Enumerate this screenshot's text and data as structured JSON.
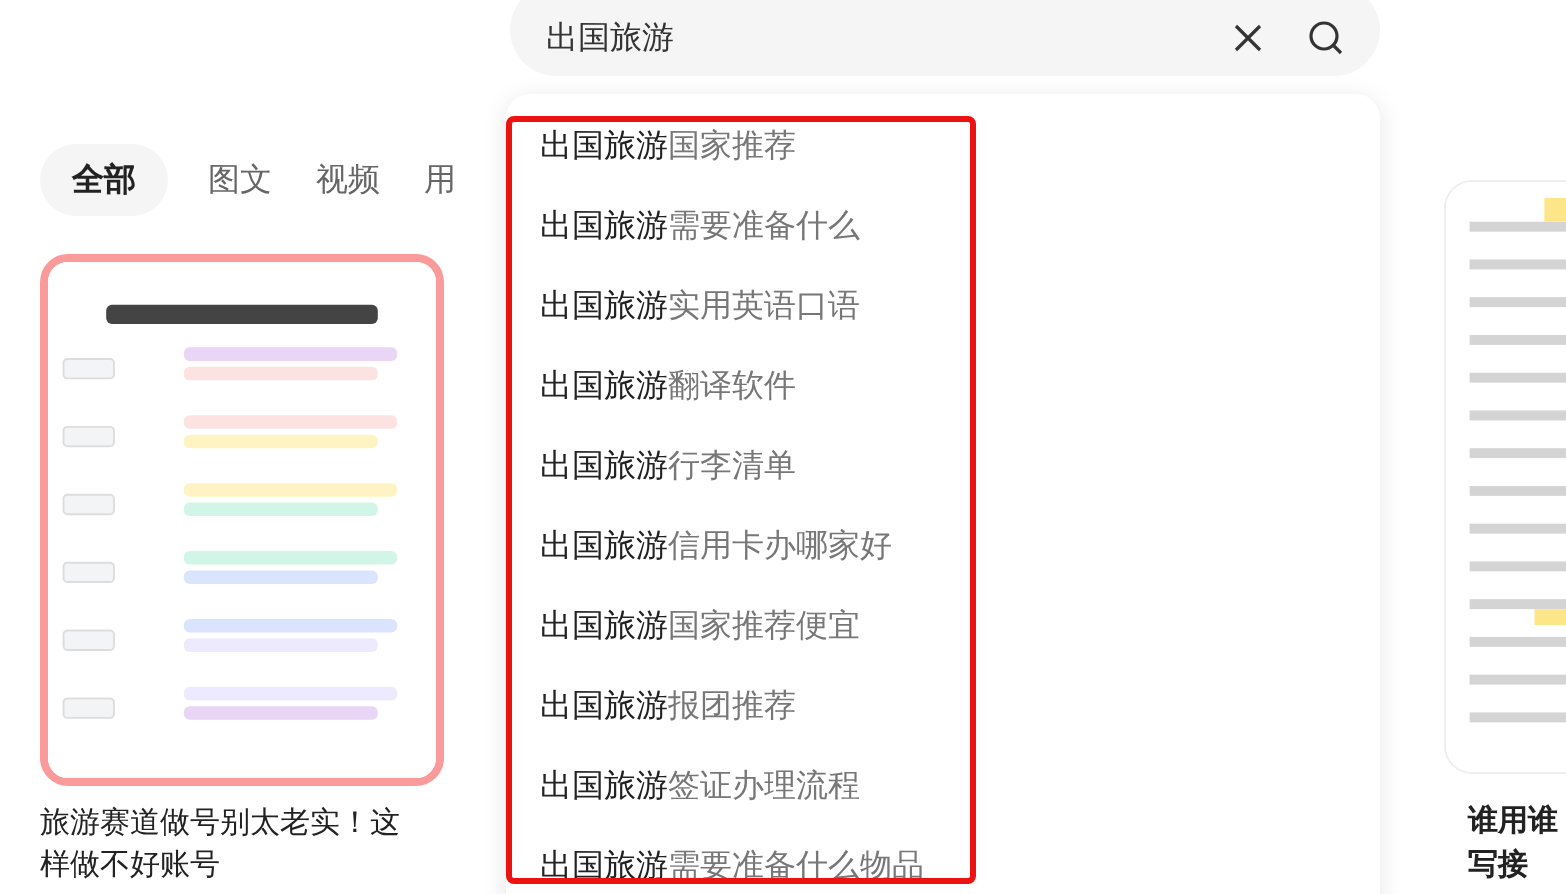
{
  "search": {
    "value": "出国旅游"
  },
  "tabs": [
    {
      "label": "全部",
      "selected": true
    },
    {
      "label": "图文",
      "selected": false
    },
    {
      "label": "视频",
      "selected": false
    },
    {
      "label": "用",
      "selected": false
    }
  ],
  "suggestions": [
    {
      "match": "出国旅游",
      "rest": "国家推荐"
    },
    {
      "match": "出国旅游",
      "rest": "需要准备什么"
    },
    {
      "match": "出国旅游",
      "rest": "实用英语口语"
    },
    {
      "match": "出国旅游",
      "rest": "翻译软件"
    },
    {
      "match": "出国旅游",
      "rest": "行李清单"
    },
    {
      "match": "出国旅游",
      "rest": "信用卡办哪家好"
    },
    {
      "match": "出国旅游",
      "rest": "国家推荐便宜"
    },
    {
      "match": "出国旅游",
      "rest": "报团推荐"
    },
    {
      "match": "出国旅游",
      "rest": "签证办理流程"
    },
    {
      "match": "出国旅游",
      "rest": "需要准备什么物品"
    }
  ],
  "cards": [
    {
      "kind": "picture",
      "title": "旅游赛道做号别太老实！这样做不好账号"
    },
    {
      "kind": "picture",
      "title_lines": [
        "谁用谁",
        "写接"
      ]
    }
  ]
}
